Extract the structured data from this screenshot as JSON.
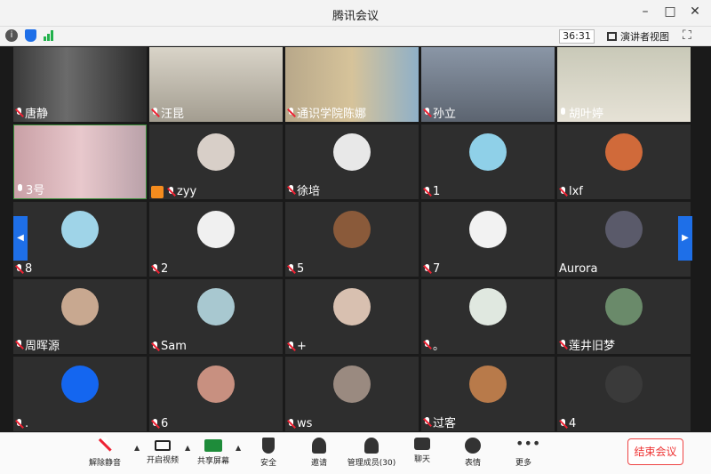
{
  "window": {
    "title": "腾讯会议"
  },
  "topbar": {
    "timer": "36:31",
    "speaker_view": "演讲者视图"
  },
  "tiles": [
    {
      "name": "唐静",
      "muted": true
    },
    {
      "name": "汪昆",
      "muted": true
    },
    {
      "name": "通识学院陈娜",
      "muted": true
    },
    {
      "name": "孙立",
      "muted": true
    },
    {
      "name": "胡叶婷",
      "muted": false
    },
    {
      "name": "3号",
      "muted": false
    },
    {
      "name": "zyy",
      "muted": true
    },
    {
      "name": "徐培",
      "muted": true
    },
    {
      "name": "1",
      "muted": true
    },
    {
      "name": "lxf",
      "muted": true
    },
    {
      "name": "8",
      "muted": true
    },
    {
      "name": "2",
      "muted": true
    },
    {
      "name": "5",
      "muted": true
    },
    {
      "name": "7",
      "muted": true
    },
    {
      "name": "Aurora",
      "muted": false
    },
    {
      "name": "周晖源",
      "muted": true
    },
    {
      "name": "Sam",
      "muted": true
    },
    {
      "name": "+",
      "muted": true
    },
    {
      "name": "。",
      "muted": true
    },
    {
      "name": "莲井旧梦",
      "muted": true
    },
    {
      "name": ".",
      "muted": true
    },
    {
      "name": "6",
      "muted": true
    },
    {
      "name": "ws",
      "muted": true
    },
    {
      "name": "过客",
      "muted": true
    },
    {
      "name": "4",
      "muted": true
    }
  ],
  "toolbar": {
    "unmute": "解除静音",
    "video": "开启视频",
    "share": "共享屏幕",
    "security": "安全",
    "invite": "邀请",
    "manage": "管理成员(30)",
    "chat": "聊天",
    "reaction": "表情",
    "more": "更多",
    "end": "结束会议"
  },
  "colors": {
    "accent": "#1e6fe8",
    "danger": "#e33333",
    "host_badge": "#f58c1e",
    "tile_bg": "#2e2e2e"
  }
}
